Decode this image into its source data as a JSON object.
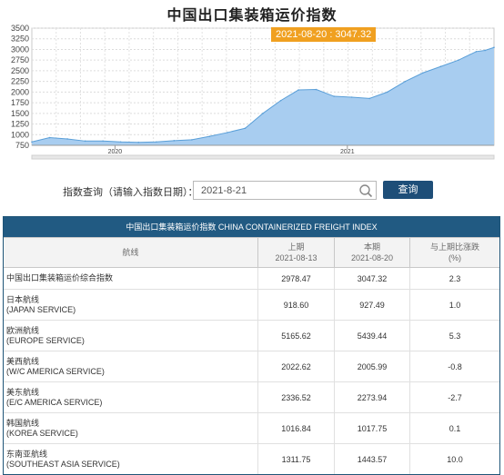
{
  "title": "中国出口集装箱运价指数",
  "tooltip": "2021-08-20 : 3047.32",
  "chart_data": {
    "type": "area",
    "title": "中国出口集装箱运价指数",
    "xlabel": "",
    "ylabel": "",
    "ylim": [
      750,
      3500
    ],
    "yticks": [
      3500,
      3250,
      3000,
      2750,
      2500,
      2250,
      2000,
      1750,
      1500,
      1250,
      1000,
      750
    ],
    "xtick_labels": [
      "2020",
      "2021"
    ],
    "grid": true,
    "x": [
      "2019-08-23",
      "2019-09-20",
      "2019-10-18",
      "2019-11-15",
      "2019-12-13",
      "2020-01-10",
      "2020-02-07",
      "2020-03-06",
      "2020-04-03",
      "2020-05-01",
      "2020-05-29",
      "2020-06-26",
      "2020-07-24",
      "2020-08-21",
      "2020-09-18",
      "2020-10-16",
      "2020-11-13",
      "2020-12-11",
      "2021-01-08",
      "2021-02-05",
      "2021-03-05",
      "2021-04-02",
      "2021-04-30",
      "2021-05-28",
      "2021-06-25",
      "2021-07-23",
      "2021-08-06",
      "2021-08-20"
    ],
    "values": [
      830,
      930,
      900,
      850,
      850,
      830,
      820,
      830,
      860,
      880,
      960,
      1050,
      1150,
      1500,
      1800,
      2050,
      2060,
      1900,
      1880,
      1850,
      2000,
      2250,
      2450,
      2600,
      2750,
      2950,
      2978.47,
      3047.32
    ]
  },
  "query": {
    "label": "指数查询（请输入指数日期）：",
    "value": "2021-8-21",
    "button": "查询"
  },
  "table": {
    "title": "中国出口集装箱运价指数 CHINA CONTAINERIZED FREIGHT INDEX",
    "col_route": "航线",
    "col_prev_l1": "上期",
    "col_prev_l2": "2021-08-13",
    "col_curr_l1": "本期",
    "col_curr_l2": "2021-08-20",
    "col_change_l1": "与上期比涨跌",
    "col_change_l2": "(%)",
    "rows": [
      {
        "name": "中国出口集装箱运价综合指数",
        "sub": "",
        "prev": "2978.47",
        "curr": "3047.32",
        "change": "2.3"
      },
      {
        "name": "日本航线",
        "sub": "(JAPAN SERVICE)",
        "prev": "918.60",
        "curr": "927.49",
        "change": "1.0"
      },
      {
        "name": "欧洲航线",
        "sub": "(EUROPE SERVICE)",
        "prev": "5165.62",
        "curr": "5439.44",
        "change": "5.3"
      },
      {
        "name": "美西航线",
        "sub": "(W/C AMERICA SERVICE)",
        "prev": "2022.62",
        "curr": "2005.99",
        "change": "-0.8"
      },
      {
        "name": "美东航线",
        "sub": "(E/C AMERICA SERVICE)",
        "prev": "2336.52",
        "curr": "2273.94",
        "change": "-2.7"
      },
      {
        "name": "韩国航线",
        "sub": "(KOREA SERVICE)",
        "prev": "1016.84",
        "curr": "1017.75",
        "change": "0.1"
      },
      {
        "name": "东南亚航线",
        "sub": "(SOUTHEAST ASIA SERVICE)",
        "prev": "1311.75",
        "curr": "1443.57",
        "change": "10.0"
      }
    ]
  },
  "colors": {
    "area_fill": "#a8cdf0",
    "area_line": "#5a9fd8",
    "tooltip_bg": "#f0a020",
    "header_bg": "#215a82"
  }
}
